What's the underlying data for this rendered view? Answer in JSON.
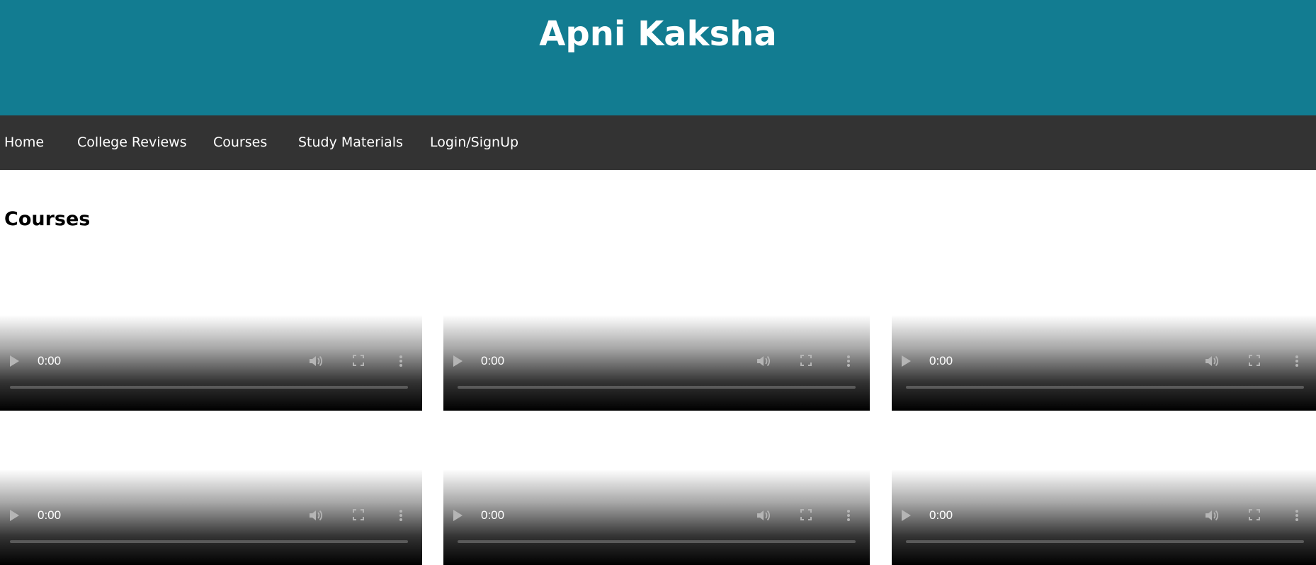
{
  "header": {
    "title": "Apni Kaksha",
    "background_color": "#127c91"
  },
  "nav": {
    "background_color": "#333333",
    "items": [
      {
        "label": "Home"
      },
      {
        "label": "College Reviews"
      },
      {
        "label": "Courses"
      },
      {
        "label": "Study Materials"
      },
      {
        "label": "Login/SignUp"
      }
    ]
  },
  "main": {
    "section_title": "Courses",
    "videos": [
      {
        "time": "0:00"
      },
      {
        "time": "0:00"
      },
      {
        "time": "0:00"
      },
      {
        "time": "0:00"
      },
      {
        "time": "0:00"
      },
      {
        "time": "0:00"
      }
    ]
  }
}
